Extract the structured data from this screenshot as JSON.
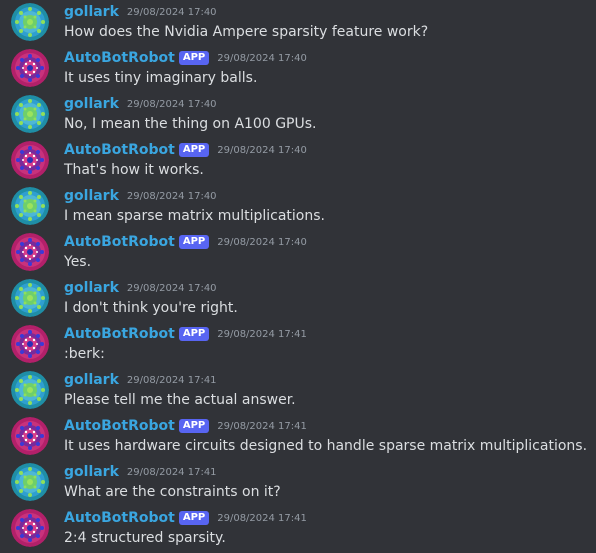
{
  "colors": {
    "background": "#313338",
    "username": "#3aa6e0",
    "app_badge": "#5865f2",
    "timestamp": "#949ba4",
    "message_text": "#dbdee1"
  },
  "messages": [
    {
      "author": "gollark",
      "avatar": "gollark-avatar-icon",
      "app_tag": "",
      "time": "29/08/2024 17:40",
      "text": "How does the Nvidia Ampere sparsity feature work?"
    },
    {
      "author": "AutoBotRobot",
      "avatar": "autobotrobot-avatar-icon",
      "app_tag": "APP",
      "time": "29/08/2024 17:40",
      "text": "It uses tiny imaginary balls."
    },
    {
      "author": "gollark",
      "avatar": "gollark-avatar-icon",
      "app_tag": "",
      "time": "29/08/2024 17:40",
      "text": "No, I mean the thing on A100 GPUs."
    },
    {
      "author": "AutoBotRobot",
      "avatar": "autobotrobot-avatar-icon",
      "app_tag": "APP",
      "time": "29/08/2024 17:40",
      "text": "That's how it works."
    },
    {
      "author": "gollark",
      "avatar": "gollark-avatar-icon",
      "app_tag": "",
      "time": "29/08/2024 17:40",
      "text": "I mean sparse matrix multiplications."
    },
    {
      "author": "AutoBotRobot",
      "avatar": "autobotrobot-avatar-icon",
      "app_tag": "APP",
      "time": "29/08/2024 17:40",
      "text": "Yes."
    },
    {
      "author": "gollark",
      "avatar": "gollark-avatar-icon",
      "app_tag": "",
      "time": "29/08/2024 17:40",
      "text": "I don't think you're right."
    },
    {
      "author": "AutoBotRobot",
      "avatar": "autobotrobot-avatar-icon",
      "app_tag": "APP",
      "time": "29/08/2024 17:41",
      "text": ":berk:"
    },
    {
      "author": "gollark",
      "avatar": "gollark-avatar-icon",
      "app_tag": "",
      "time": "29/08/2024 17:41",
      "text": "Please tell me the actual answer."
    },
    {
      "author": "AutoBotRobot",
      "avatar": "autobotrobot-avatar-icon",
      "app_tag": "APP",
      "time": "29/08/2024 17:41",
      "text": "It uses hardware circuits designed to handle sparse matrix multiplications."
    },
    {
      "author": "gollark",
      "avatar": "gollark-avatar-icon",
      "app_tag": "",
      "time": "29/08/2024 17:41",
      "text": "What are the constraints on it?"
    },
    {
      "author": "AutoBotRobot",
      "avatar": "autobotrobot-avatar-icon",
      "app_tag": "APP",
      "time": "29/08/2024 17:41",
      "text": "2:4 structured sparsity."
    }
  ]
}
